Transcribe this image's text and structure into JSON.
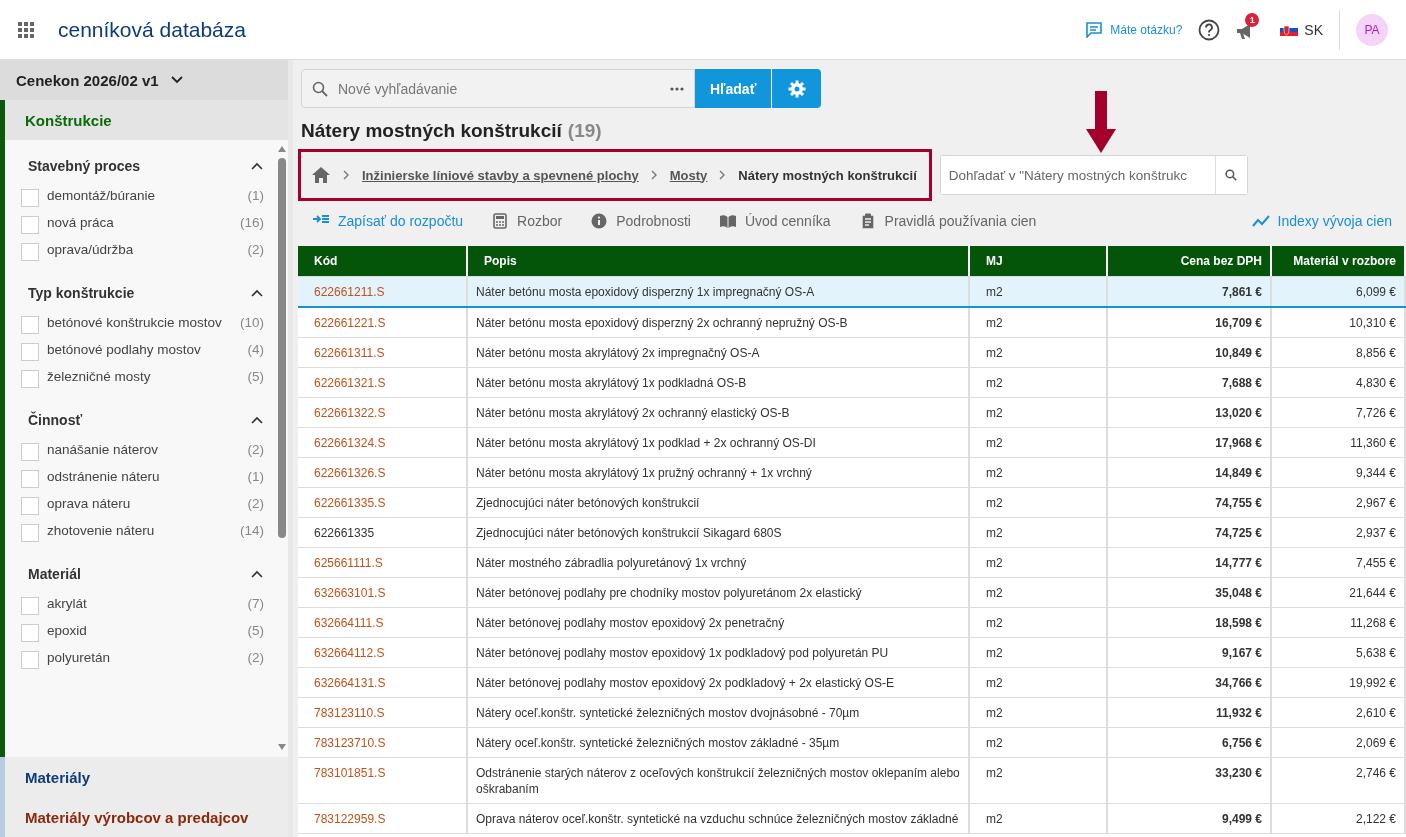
{
  "header": {
    "app_title": "cenníková databáza",
    "question_link": "Máte otázku?",
    "notification_count": "1",
    "language": "SK",
    "avatar": "PA"
  },
  "sidebar": {
    "version": "Cenekon 2026/02 v1",
    "sections": [
      {
        "label": "Konštrukcie",
        "selected": true,
        "color": "#0b6b0b"
      },
      {
        "label": "Materiály",
        "selected": false,
        "color": "#0d3c78"
      },
      {
        "label": "Materiály výrobcov a predajcov",
        "selected": false,
        "color": "#8a2a0a"
      }
    ],
    "filter_groups": [
      {
        "title": "Stavebný proces",
        "expanded": true,
        "items": [
          {
            "label": "demontáž/búranie",
            "count": "(1)",
            "checked": false
          },
          {
            "label": "nová práca",
            "count": "(16)",
            "checked": false
          },
          {
            "label": "oprava/údržba",
            "count": "(2)",
            "checked": false
          }
        ]
      },
      {
        "title": "Typ konštrukcie",
        "expanded": true,
        "items": [
          {
            "label": "betónové konštrukcie mostov",
            "count": "(10)",
            "checked": false
          },
          {
            "label": "betónové podlahy mostov",
            "count": "(4)",
            "checked": false
          },
          {
            "label": "železničné mosty",
            "count": "(5)",
            "checked": false
          }
        ]
      },
      {
        "title": "Činnosť",
        "expanded": true,
        "items": [
          {
            "label": "nanášanie náterov",
            "count": "(2)",
            "checked": false
          },
          {
            "label": "odstránenie náteru",
            "count": "(1)",
            "checked": false
          },
          {
            "label": "oprava náteru",
            "count": "(2)",
            "checked": false
          },
          {
            "label": "zhotovenie náteru",
            "count": "(14)",
            "checked": false
          }
        ]
      },
      {
        "title": "Materiál",
        "expanded": true,
        "items": [
          {
            "label": "akrylát",
            "count": "(7)",
            "checked": false
          },
          {
            "label": "epoxid",
            "count": "(5)",
            "checked": false
          },
          {
            "label": "polyuretán",
            "count": "(2)",
            "checked": false
          }
        ]
      }
    ]
  },
  "search": {
    "placeholder": "Nové vyhľadávanie",
    "button": "Hľadať"
  },
  "page_title": "Nátery mostných konštrukcií",
  "result_count": "(19)",
  "breadcrumb": [
    {
      "label": "Inžinierske líniové stavby a spevnené plochy",
      "current": false
    },
    {
      "label": "Mosty",
      "current": false
    },
    {
      "label": "Nátery mostných konštrukcií",
      "current": true
    }
  ],
  "filter_search": {
    "placeholder": "Dohľadať v \"Nátery mostných konštrukc"
  },
  "toolbar": [
    {
      "kind": "budget",
      "label": "Zapísať do rozpočtu",
      "primary": true
    },
    {
      "kind": "calculator",
      "label": "Rozbor",
      "primary": false
    },
    {
      "kind": "info",
      "label": "Podrobnosti",
      "primary": false
    },
    {
      "kind": "book",
      "label": "Úvod cenníka",
      "primary": false
    },
    {
      "kind": "clipboard",
      "label": "Pravidlá používania cien",
      "primary": false
    }
  ],
  "indexes_link": "Indexy vývoja cien",
  "table": {
    "columns": [
      "Kód",
      "Popis",
      "MJ",
      "Cena bez DPH",
      "Materiál v rozbore"
    ],
    "rows": [
      {
        "code": "622661211.S",
        "linked": true,
        "selected": true,
        "description": "Náter betónu mosta epoxidový disperzný 1x impregnačný OS-A",
        "unit": "m2",
        "price": "7,861 €",
        "material": "6,099 €"
      },
      {
        "code": "622661221.S",
        "linked": true,
        "selected": false,
        "description": "Náter betónu mosta epoxidový disperzný 2x ochranný nepružný OS-B",
        "unit": "m2",
        "price": "16,709 €",
        "material": "10,310 €"
      },
      {
        "code": "622661311.S",
        "linked": true,
        "selected": false,
        "description": "Náter betónu mosta akrylátový 2x impregnačný OS-A",
        "unit": "m2",
        "price": "10,849 €",
        "material": "8,856 €"
      },
      {
        "code": "622661321.S",
        "linked": true,
        "selected": false,
        "description": "Náter betónu mosta akrylátový 1x podkladná OS-B",
        "unit": "m2",
        "price": "7,688 €",
        "material": "4,830 €"
      },
      {
        "code": "622661322.S",
        "linked": true,
        "selected": false,
        "description": "Náter betónu mosta akrylátový 2x ochranný elastický OS-B",
        "unit": "m2",
        "price": "13,020 €",
        "material": "7,726 €"
      },
      {
        "code": "622661324.S",
        "linked": true,
        "selected": false,
        "description": "Náter betónu mosta akrylátový 1x podklad + 2x ochranný OS-DI",
        "unit": "m2",
        "price": "17,968 €",
        "material": "11,360 €"
      },
      {
        "code": "622661326.S",
        "linked": true,
        "selected": false,
        "description": "Náter betónu mosta akrylátový 1x pružný ochranný + 1x vrchný",
        "unit": "m2",
        "price": "14,849 €",
        "material": "9,344 €"
      },
      {
        "code": "622661335.S",
        "linked": true,
        "selected": false,
        "description": "Zjednocujúci náter betónových konštrukcií",
        "unit": "m2",
        "price": "74,755 €",
        "material": "2,967 €"
      },
      {
        "code": "622661335",
        "linked": false,
        "selected": false,
        "description": "Zjednocujúci náter betónových konštrukcií Sikagard 680S",
        "unit": "m2",
        "price": "74,725 €",
        "material": "2,937 €"
      },
      {
        "code": "625661111.S",
        "linked": true,
        "selected": false,
        "description": "Náter mostného zábradlia polyuretánový 1x vrchný",
        "unit": "m2",
        "price": "14,777 €",
        "material": "7,455 €"
      },
      {
        "code": "632663101.S",
        "linked": true,
        "selected": false,
        "description": "Náter betónovej podlahy pre chodníky mostov polyuretánom 2x elastický",
        "unit": "m2",
        "price": "35,048 €",
        "material": "21,644 €"
      },
      {
        "code": "632664111.S",
        "linked": true,
        "selected": false,
        "description": "Náter betónovej podlahy mostov epoxidový 2x penetračný",
        "unit": "m2",
        "price": "18,598 €",
        "material": "11,268 €"
      },
      {
        "code": "632664112.S",
        "linked": true,
        "selected": false,
        "description": "Náter betónovej podlahy mostov epoxidový 1x podkladový pod polyuretán PU",
        "unit": "m2",
        "price": "9,167 €",
        "material": "5,638 €"
      },
      {
        "code": "632664131.S",
        "linked": true,
        "selected": false,
        "description": "Náter betónovej podlahy mostov epoxidový 2x podkladový + 2x elastický OS-E",
        "unit": "m2",
        "price": "34,766 €",
        "material": "19,992 €"
      },
      {
        "code": "783123110.S",
        "linked": true,
        "selected": false,
        "description": "Nátery oceľ.konštr. syntetické železničných mostov dvojnásobné - 70µm",
        "unit": "m2",
        "price": "11,932 €",
        "material": "2,610 €"
      },
      {
        "code": "783123710.S",
        "linked": true,
        "selected": false,
        "description": "Nátery oceľ.konštr. syntetické železničných mostov základné - 35µm",
        "unit": "m2",
        "price": "6,756 €",
        "material": "2,069 €"
      },
      {
        "code": "783101851.S",
        "linked": true,
        "selected": false,
        "description": "Odstránenie starých náterov z oceľových konštrukcií železničných mostov oklepaním alebo oškrabaním",
        "unit": "m2",
        "price": "33,230 €",
        "material": "2,746 €"
      },
      {
        "code": "783122959.S",
        "linked": true,
        "selected": false,
        "description": "Oprava náterov oceľ.konštr. syntetické na vzduchu schnúce železničných mostov základné",
        "unit": "m2",
        "price": "9,499 €",
        "material": "2,122 €"
      }
    ]
  }
}
